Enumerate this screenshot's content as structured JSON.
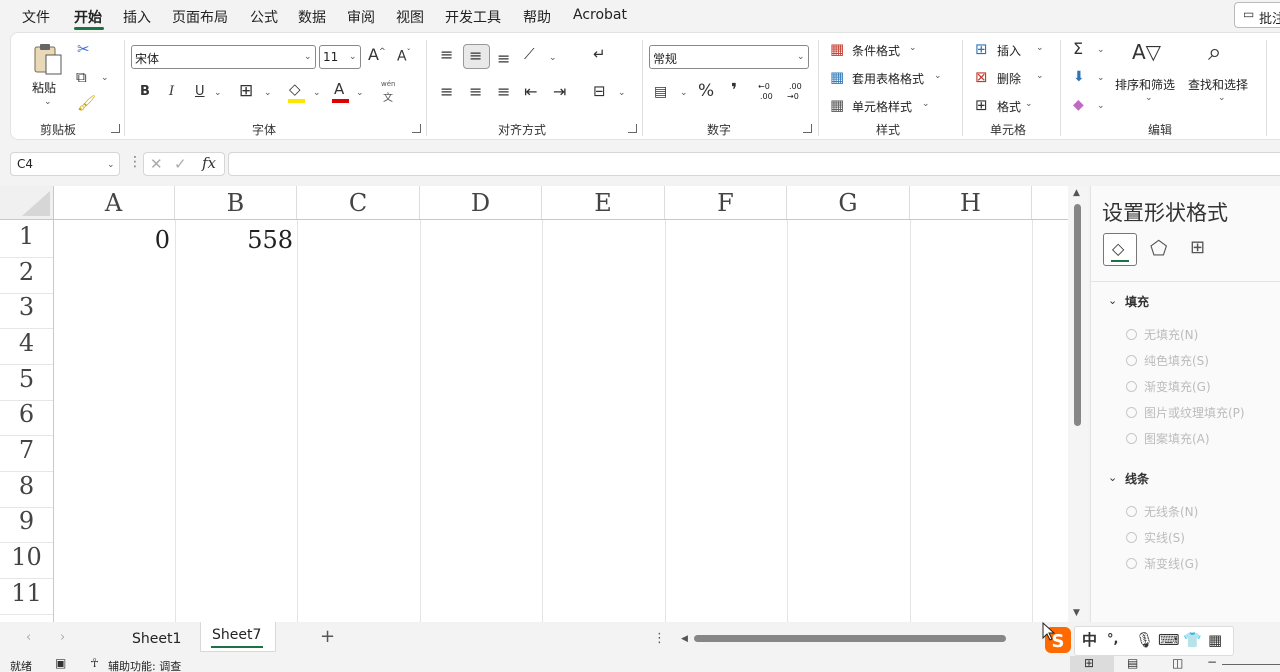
{
  "menu": {
    "items": [
      "文件",
      "开始",
      "插入",
      "页面布局",
      "公式",
      "数据",
      "审阅",
      "视图",
      "开发工具",
      "帮助",
      "Acrobat"
    ],
    "active": "开始",
    "review_button": "批注"
  },
  "ribbon": {
    "clipboard": {
      "paste": "粘贴",
      "group": "剪贴板"
    },
    "font": {
      "name": "宋体",
      "size": "11",
      "group": "字体",
      "bold": "B",
      "italic": "I",
      "underline": "U",
      "phonetic_top": "wén",
      "phonetic_bottom": "文",
      "grow": "A",
      "shrink": "A"
    },
    "alignment": {
      "group": "对齐方式"
    },
    "number": {
      "format": "常规",
      "group": "数字",
      "percent": "%",
      "comma": "❜",
      "inc_decimal_top": "←0",
      "inc_decimal_bottom": ".00",
      "dec_decimal_top": ".00",
      "dec_decimal_bottom": "→0"
    },
    "styles": {
      "conditional": "条件格式",
      "table": "套用表格格式",
      "cell": "单元格样式",
      "group": "样式"
    },
    "cells": {
      "insert": "插入",
      "delete": "删除",
      "format": "格式",
      "group": "单元格"
    },
    "editing": {
      "sort": "排序和筛选",
      "find": "查找和选择",
      "group": "编辑"
    }
  },
  "formula_bar": {
    "name_box": "C4",
    "fx": "fx",
    "value": ""
  },
  "sheet": {
    "columns": [
      "A",
      "B",
      "C",
      "D",
      "E",
      "F",
      "G",
      "H"
    ],
    "rows": [
      "1",
      "2",
      "3",
      "4",
      "5",
      "6",
      "7",
      "8",
      "9",
      "10",
      "11"
    ],
    "cells": {
      "A1": "0",
      "B1": "558"
    }
  },
  "format_pane": {
    "title": "设置形状格式",
    "fill_section": "填充",
    "fill_options": [
      "无填充(N)",
      "纯色填充(S)",
      "渐变填充(G)",
      "图片或纹理填充(P)",
      "图案填充(A)"
    ],
    "line_section": "线条",
    "line_options": [
      "无线条(N)",
      "实线(S)",
      "渐变线(G)"
    ]
  },
  "tabs": {
    "items": [
      "Sheet1",
      "Sheet7"
    ],
    "active": "Sheet7",
    "add": "+"
  },
  "status": {
    "ready": "就绪",
    "accessibility": "辅助功能: 调查"
  },
  "ime": {
    "lang": "中",
    "punct": "°,"
  },
  "colors": {
    "accent": "#1e7145",
    "font_color_bar": "#e00000",
    "highlight_bar": "#ffe600"
  }
}
